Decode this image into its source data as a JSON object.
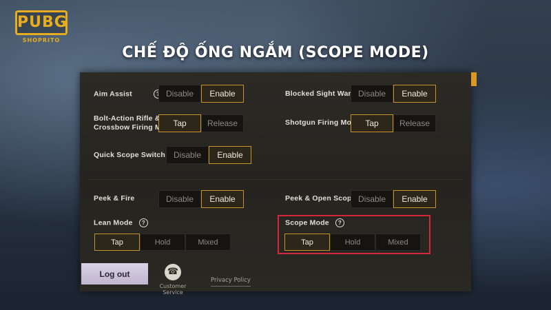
{
  "brand": {
    "logo_text": "PUBG",
    "logo_sub": "SHOPRITO"
  },
  "headline": "CHẾ ĐỘ ỐNG NGẮM (SCOPE MODE)",
  "settings": {
    "aim_assist": {
      "label": "Aim Assist",
      "help": "?",
      "options": [
        "Disable",
        "Enable"
      ],
      "selected": "Enable"
    },
    "blocked_sight": {
      "label": "Blocked Sight Warning",
      "options": [
        "Disable",
        "Enable"
      ],
      "selected": "Enable"
    },
    "bolt_action": {
      "label_line1": "Bolt-Action Rifle &",
      "label_line2": "Crossbow Firing Mode",
      "options": [
        "Tap",
        "Release"
      ],
      "selected": "Tap"
    },
    "shotgun": {
      "label": "Shotgun Firing Mode",
      "options": [
        "Tap",
        "Release"
      ],
      "selected": "Tap"
    },
    "quick_scope": {
      "label": "Quick Scope Switch",
      "options": [
        "Disable",
        "Enable"
      ],
      "selected": "Enable"
    },
    "peek_fire": {
      "label": "Peek & Fire",
      "options": [
        "Disable",
        "Enable"
      ],
      "selected": "Enable"
    },
    "peek_open_scope": {
      "label": "Peek & Open Scope",
      "options": [
        "Disable",
        "Enable"
      ],
      "selected": "Enable"
    },
    "lean_mode": {
      "label": "Lean Mode",
      "help": "?",
      "options": [
        "Tap",
        "Hold",
        "Mixed"
      ],
      "selected": "Tap"
    },
    "scope_mode": {
      "label": "Scope Mode",
      "help": "?",
      "options": [
        "Tap",
        "Hold",
        "Mixed"
      ],
      "selected": "Tap"
    }
  },
  "footer": {
    "logout": "Log out",
    "customer_service": "Customer Service",
    "privacy": "Privacy Policy"
  },
  "colors": {
    "accent": "#c8942a",
    "highlight_box": "#d5273b",
    "logo": "#e7ad1f"
  }
}
